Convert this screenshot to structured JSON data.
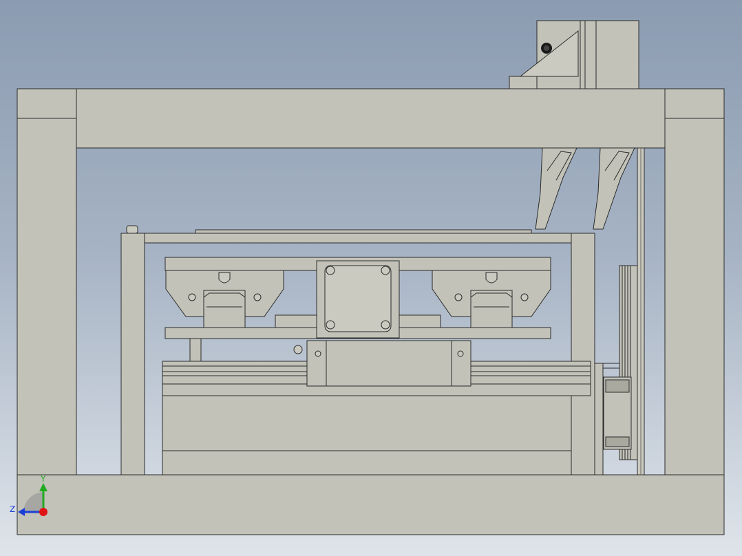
{
  "view": {
    "background_top": "#8b9bb1",
    "background_bottom": "#dfe4ea",
    "part_color": "#c2c2b8",
    "edge_color": "#2b2b2b"
  },
  "triad": {
    "y_label": "Y",
    "z_label": "Z",
    "y_color": "#22aa22",
    "z_color": "#1a3fd6",
    "x_color": "#e01414"
  }
}
